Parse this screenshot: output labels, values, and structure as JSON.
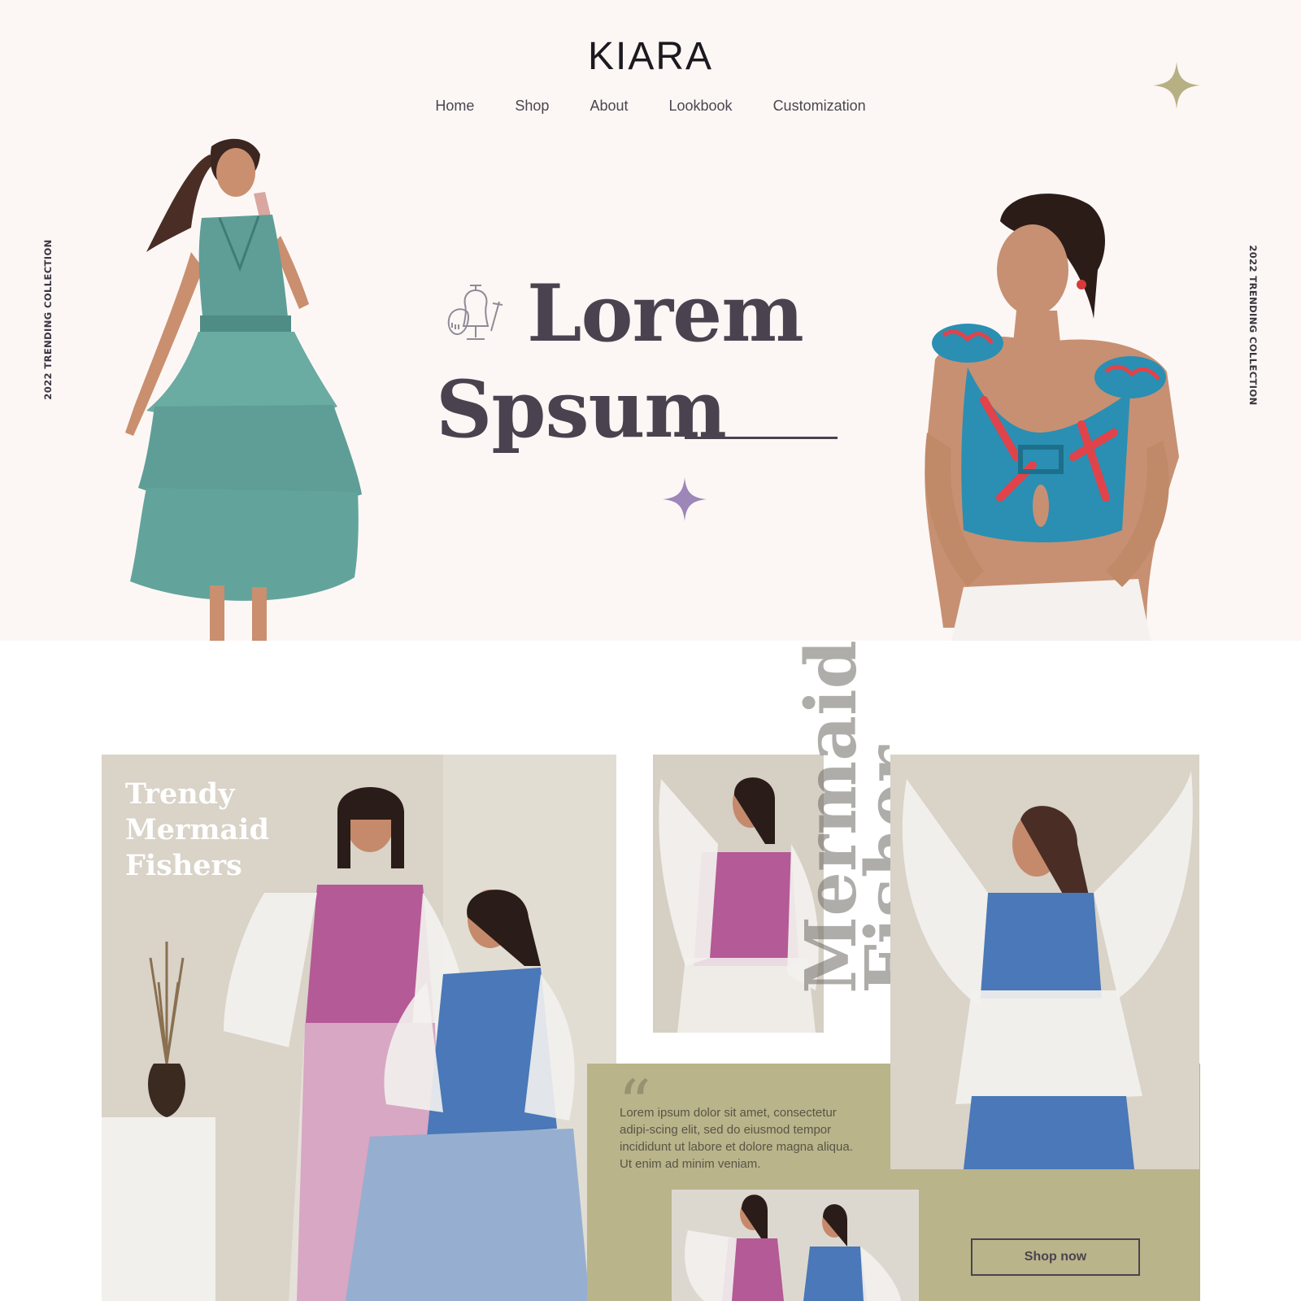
{
  "brand": {
    "logo": "KIARA"
  },
  "nav": {
    "items": [
      "Home",
      "Shop",
      "About",
      "Lookbook",
      "Customization"
    ]
  },
  "hero": {
    "side_left": "2022 TRENDING COLLECTION",
    "side_right": "2022 TRENDING COLLECTION",
    "headline_line1": "Lorem",
    "headline_line2": "Spsum"
  },
  "collection": {
    "title_lines": [
      "Trendy",
      "Mermaid",
      "Fishers"
    ],
    "vertical_line1": "Mermaid",
    "vertical_line2": "Fisher",
    "quote_mark": "“",
    "quote": "Lorem ipsum dolor sit amet, consectetur adipi-scing elit, sed do eiusmod tempor incididunt ut labore et dolore magna aliqua. Ut enim ad minim veniam.",
    "cta": "Shop now"
  },
  "colors": {
    "hero_bg": "#fcf7f5",
    "text_dark": "#4a434f",
    "olive": "#b9b48a",
    "star_gold": "#b6b083",
    "star_purple": "#9d86b8",
    "teal_dress": "#5e9e96",
    "blue_top": "#2a8fb3",
    "red_print": "#e0434a",
    "pink_outfit": "#b45a96",
    "blue_outfit": "#4a78b8"
  },
  "icons": [
    "star-icon",
    "mannequin-icon"
  ]
}
